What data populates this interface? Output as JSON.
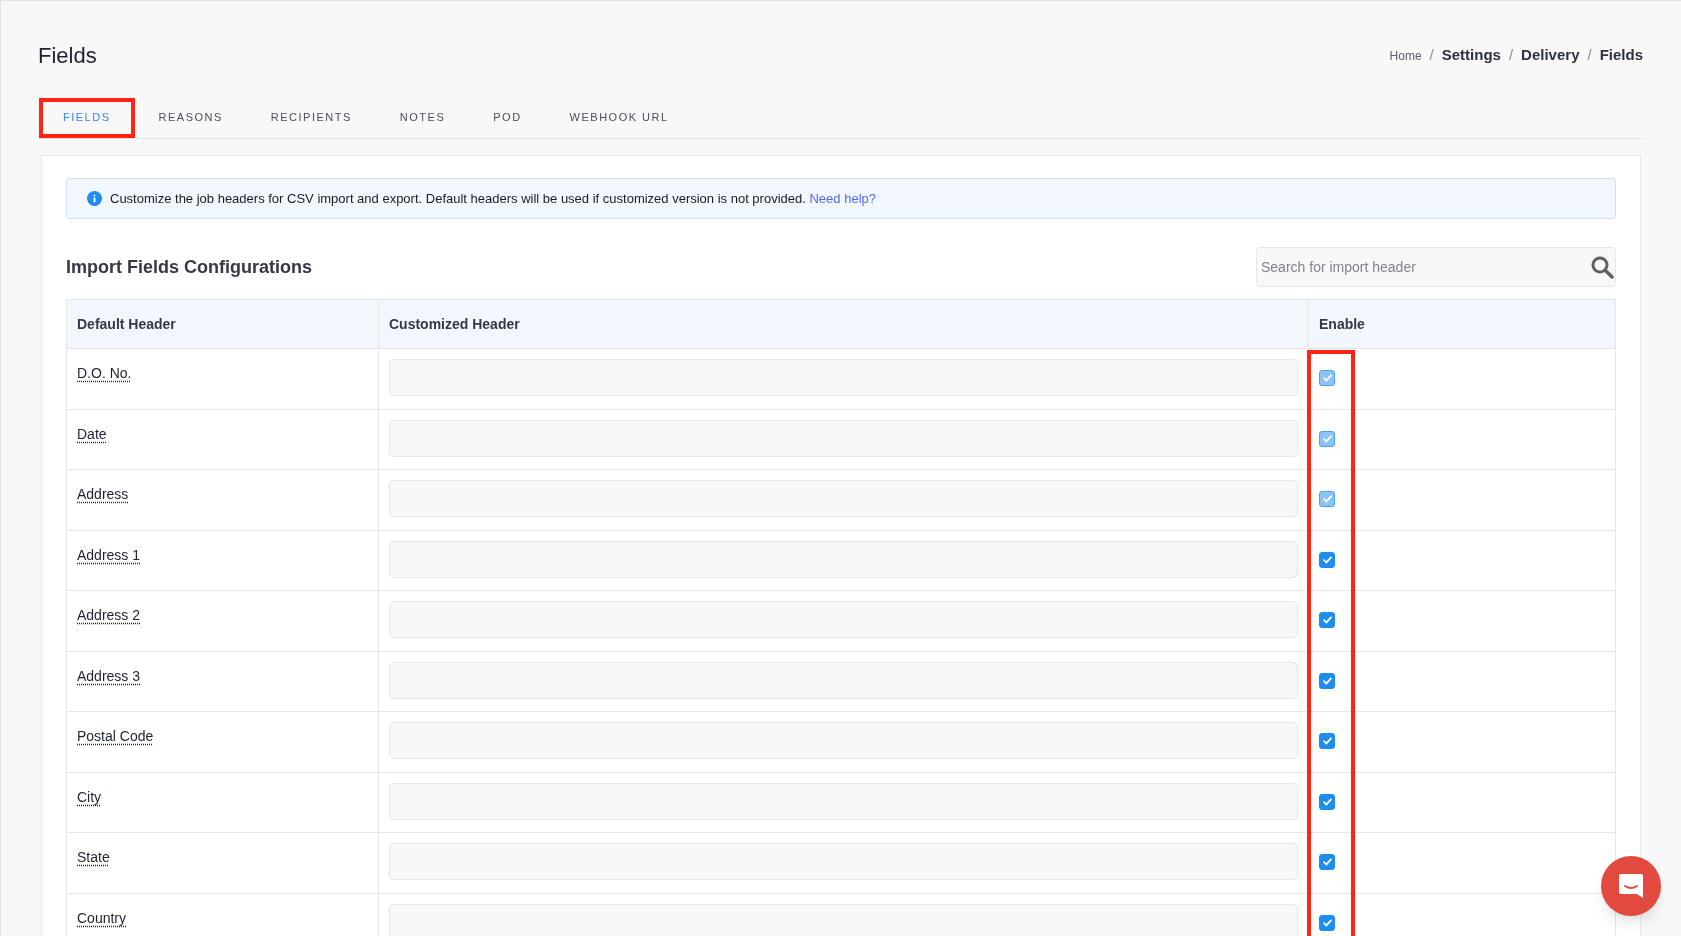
{
  "page": {
    "title": "Fields"
  },
  "breadcrumb": [
    {
      "label": "Home",
      "current": false
    },
    {
      "separator": "/",
      "label": "Settings",
      "current": true
    },
    {
      "separator": "/",
      "label": "Delivery",
      "current": true
    },
    {
      "separator": "/",
      "label": "Fields",
      "current": true
    }
  ],
  "tabs": [
    {
      "label": "FIELDS",
      "selected": true,
      "highlighted": true
    },
    {
      "label": "REASONS",
      "selected": false,
      "highlighted": false
    },
    {
      "label": "RECIPIENTS",
      "selected": false,
      "highlighted": false
    },
    {
      "label": "NOTES",
      "selected": false,
      "highlighted": false
    },
    {
      "label": "POD",
      "selected": false,
      "highlighted": false
    },
    {
      "label": "WEBHOOK URL",
      "selected": false,
      "highlighted": false
    }
  ],
  "info": {
    "text": "Customize the job headers for CSV import and export. Default headers will be used if customized version is not provided.",
    "link": "Need help?"
  },
  "section": {
    "title": "Import Fields Configurations",
    "search": {
      "placeholder": "Search for import header"
    }
  },
  "table": {
    "columns": [
      "Default Header",
      "Customized Header",
      "Enable"
    ],
    "enable_highlighted": true,
    "rows": [
      {
        "header": "D.O. No.",
        "value": "",
        "checked": true,
        "disabled": true
      },
      {
        "header": "Date",
        "value": "",
        "checked": true,
        "disabled": true
      },
      {
        "header": "Address",
        "value": "",
        "checked": true,
        "disabled": true
      },
      {
        "header": "Address 1",
        "value": "",
        "checked": true,
        "disabled": false
      },
      {
        "header": "Address 2",
        "value": "",
        "checked": true,
        "disabled": false
      },
      {
        "header": "Address 3",
        "value": "",
        "checked": true,
        "disabled": false
      },
      {
        "header": "Postal Code",
        "value": "",
        "checked": true,
        "disabled": false
      },
      {
        "header": "City",
        "value": "",
        "checked": true,
        "disabled": false
      },
      {
        "header": "State",
        "value": "",
        "checked": true,
        "disabled": false
      },
      {
        "header": "Country",
        "value": "",
        "checked": true,
        "disabled": false
      }
    ]
  }
}
